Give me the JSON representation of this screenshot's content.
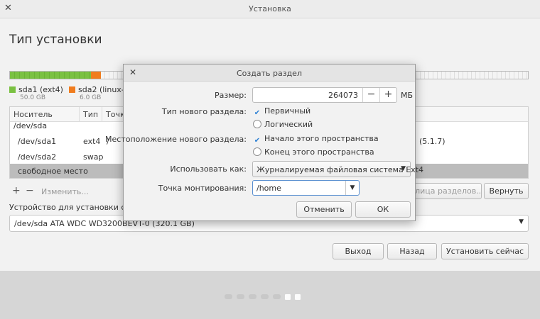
{
  "window": {
    "title": "Установка"
  },
  "page": {
    "title": "Тип установки"
  },
  "legend": [
    {
      "name": "sda1 (ext4)",
      "size": "50.0 GB",
      "color": "#7ac142"
    },
    {
      "name": "sda2 (linux-s",
      "size": "6.0 GB",
      "color": "#f07c1e"
    }
  ],
  "table": {
    "columns": [
      "Носитель",
      "Тип",
      "Точк"
    ],
    "rows": [
      {
        "device": "/dev/sda",
        "type": "",
        "mount": ""
      },
      {
        "device": "/dev/sda1",
        "type": "ext4",
        "mount": "/",
        "extra": "(5.1.7)"
      },
      {
        "device": "/dev/sda2",
        "type": "swap",
        "mount": ""
      },
      {
        "device": "свободное место",
        "type": "",
        "mount": ""
      }
    ]
  },
  "toolbar": {
    "add": "+",
    "remove": "−",
    "change": "Изменить...",
    "partition_table": "блица разделов...",
    "revert": "Вернуть"
  },
  "device": {
    "label": "Устройство для установки систе",
    "value": "/dev/sda    ATA WDC WD3200BEVT-0 (320.1 GB)"
  },
  "buttons": {
    "quit": "Выход",
    "back": "Назад",
    "install": "Установить сейчас"
  },
  "dialog": {
    "title": "Создать раздел",
    "size_label": "Размер:",
    "size_value": "264073",
    "size_unit": "МБ",
    "type_label": "Тип нового раздела:",
    "type_primary": "Первичный",
    "type_logical": "Логический",
    "location_label": "Местоположение нового раздела:",
    "location_start": "Начало этого пространства",
    "location_end": "Конец этого пространства",
    "use_as_label": "Использовать как:",
    "use_as_value": "Журналируемая файловая система Ext4",
    "mount_label": "Точка монтирования:",
    "mount_value": "/home",
    "cancel": "Отменить",
    "ok": "ОК"
  },
  "accent": "#2a7fd4"
}
